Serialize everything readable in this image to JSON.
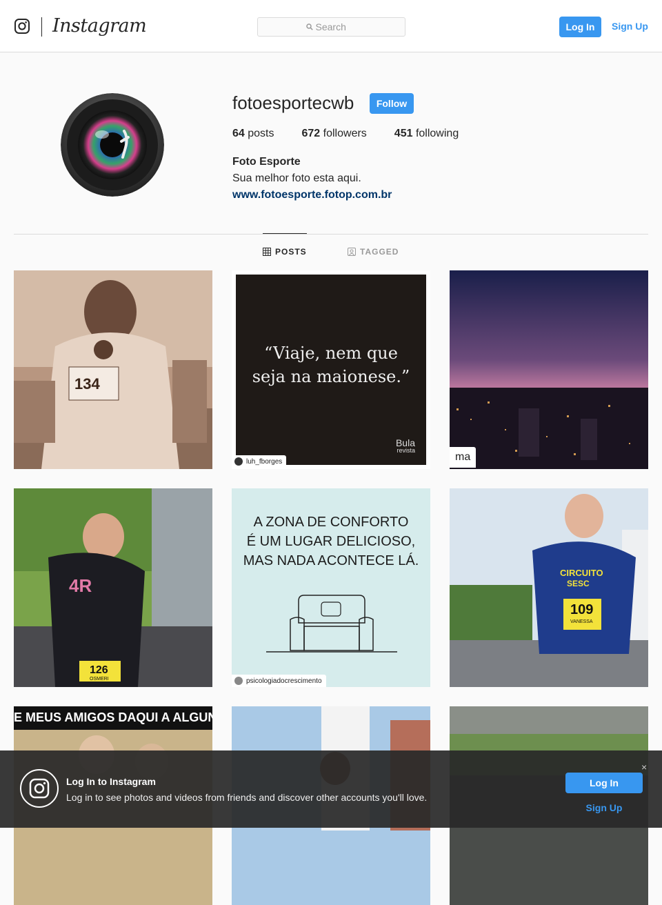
{
  "header": {
    "brand": "Instagram",
    "search_placeholder": "Search",
    "login_label": "Log In",
    "signup_label": "Sign Up"
  },
  "profile": {
    "username": "fotoesportecwb",
    "follow_label": "Follow",
    "posts_count": "64",
    "posts_label": "posts",
    "followers_count": "672",
    "followers_label": "followers",
    "following_count": "451",
    "following_label": "following",
    "full_name": "Foto Esporte",
    "bio": "Sua melhor foto esta aqui.",
    "website": "www.fotoesporte.fotop.com.br"
  },
  "tabs": [
    {
      "label": "POSTS",
      "active": true
    },
    {
      "label": "TAGGED",
      "active": false
    }
  ],
  "posts": [
    {
      "bib": "134"
    },
    {
      "quote_line1": "“Viaje, nem que",
      "quote_line2": "seja na maionese.”",
      "sig": "Bula",
      "sig2": "revista",
      "tag": "luh_fborges"
    },
    {
      "tag": "ma"
    },
    {
      "bib": "126",
      "bib_name": "OSMERI"
    },
    {
      "line1": "A ZONA DE CONFORTO",
      "line2": "É UM LUGAR DELICIOSO,",
      "line3": "MAS NADA ACONTECE LÁ.",
      "tag": "psicologiadocrescimento"
    },
    {
      "shirt1": "CIRCUITO",
      "shirt2": "SESC",
      "bib": "109",
      "bib_name": "VANESSA"
    },
    {
      "caption": "E MEUS AMIGOS DAQUI A ALGUNS A"
    },
    {},
    {}
  ],
  "banner": {
    "title": "Log In to Instagram",
    "text": "Log in to see photos and videos from friends and discover other accounts you'll love.",
    "login_label": "Log In",
    "signup_label": "Sign Up",
    "close_glyph": "×"
  },
  "colors": {
    "accent": "#3897f0",
    "link": "#003569",
    "border": "#dbdbdb",
    "background": "#fafafa"
  }
}
